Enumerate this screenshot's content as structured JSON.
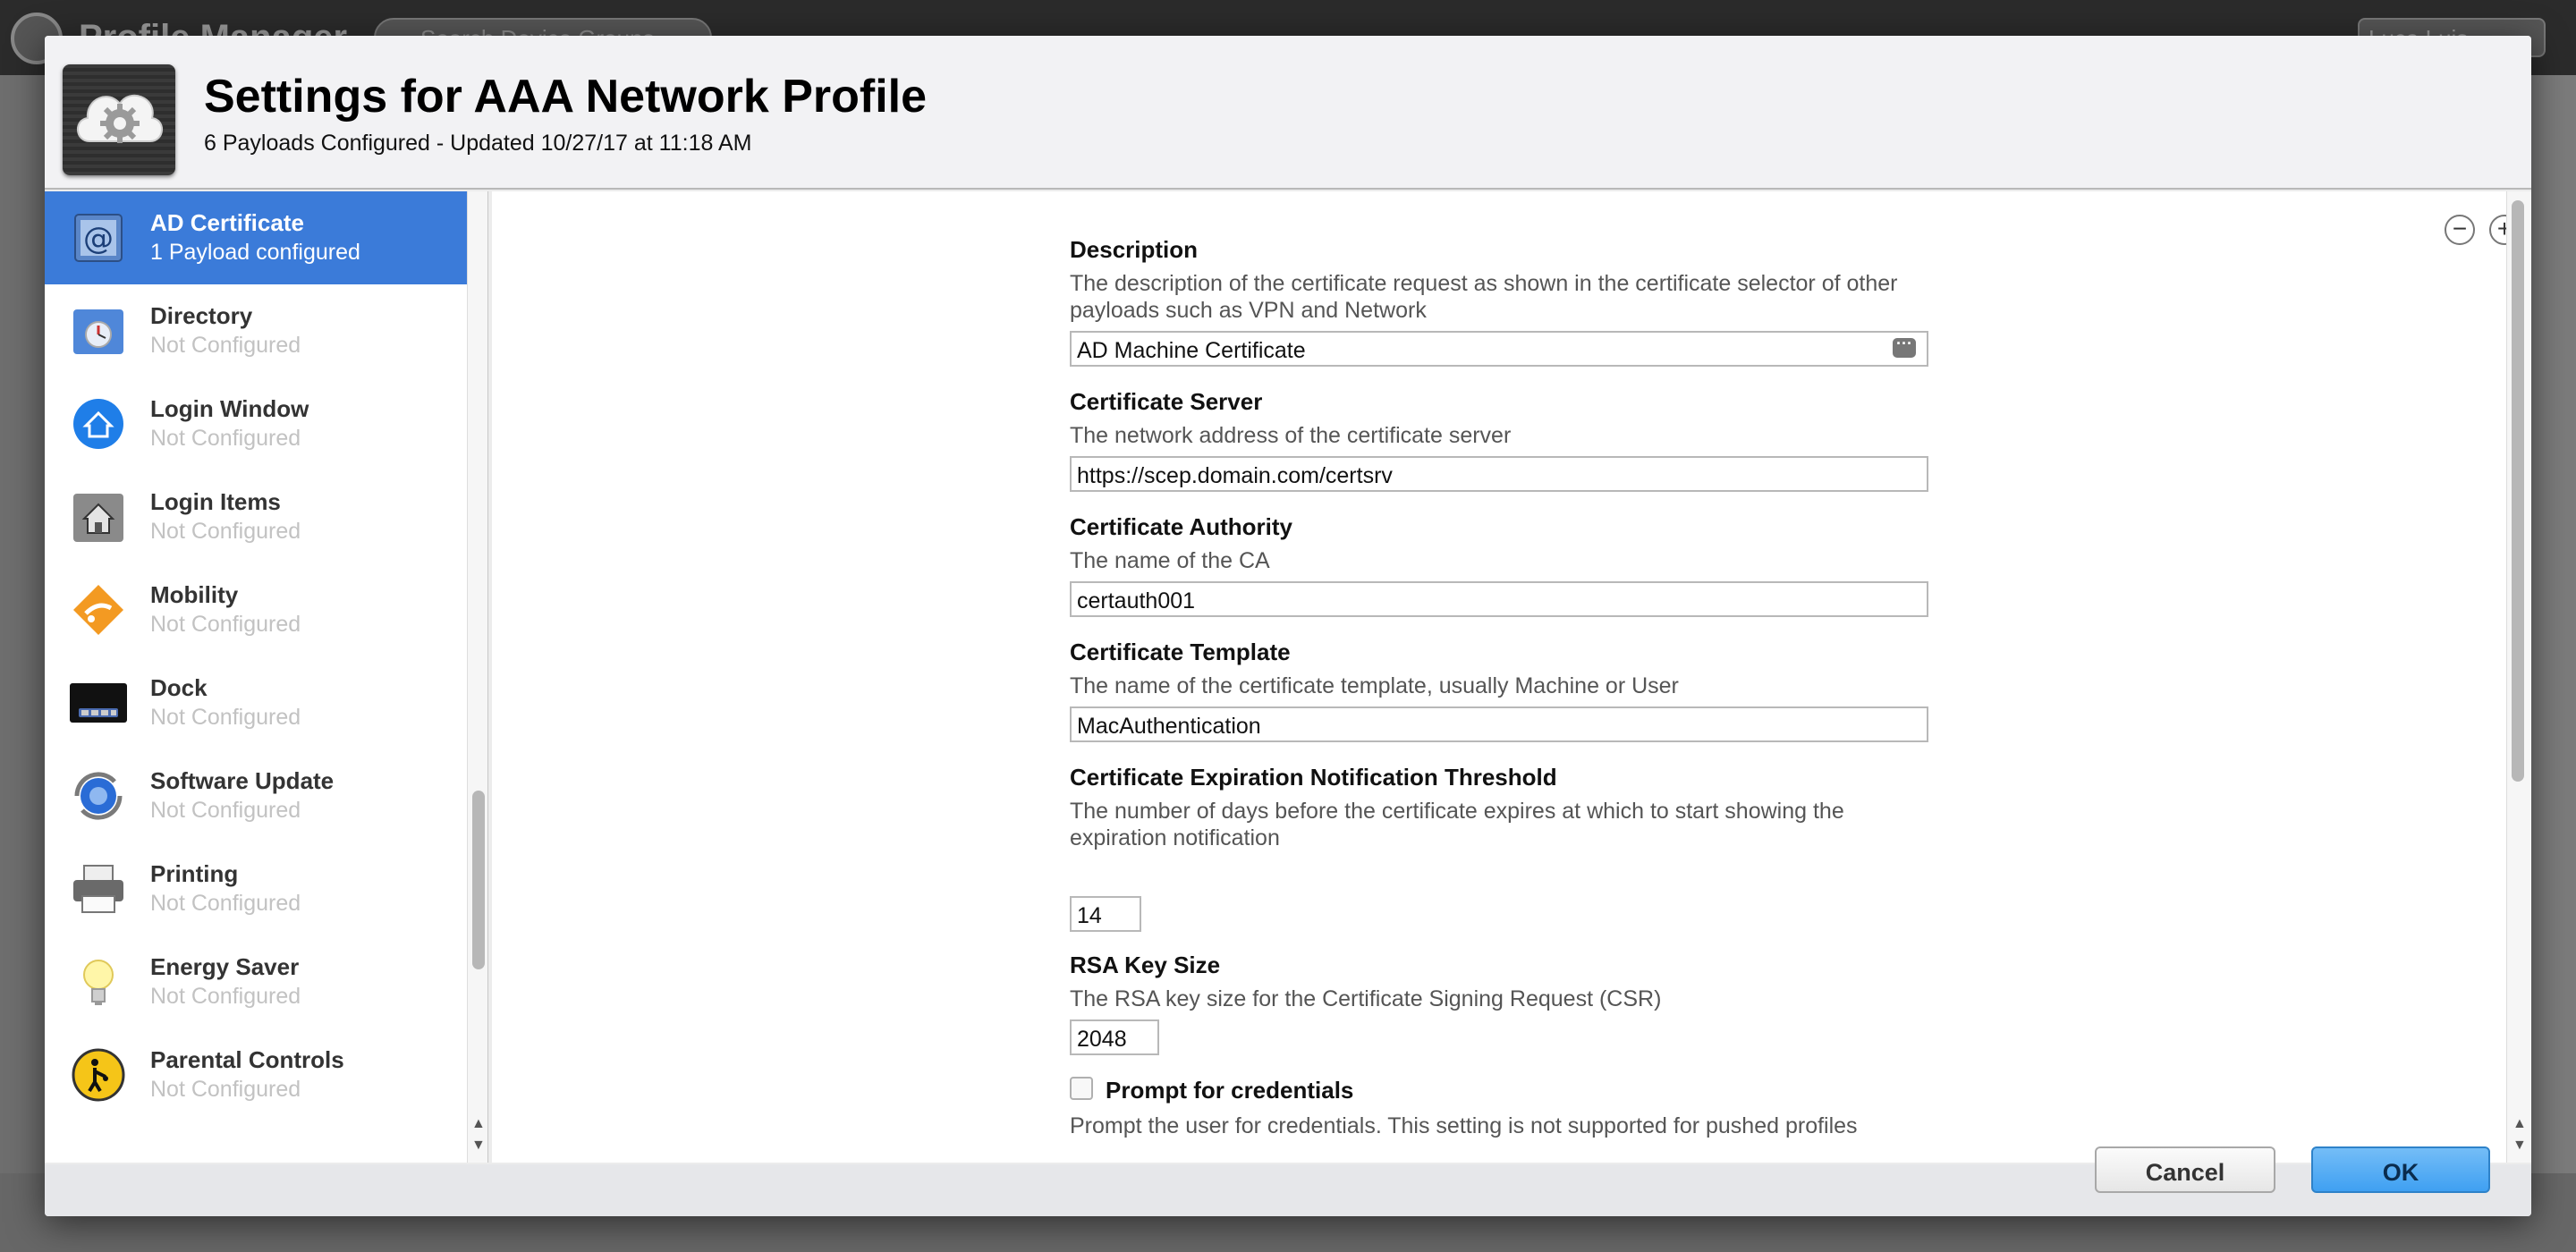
{
  "background_app": {
    "title": "Profile Manager",
    "search_placeholder": "Search Device Groups",
    "user_menu": "Luca Luis"
  },
  "sheet": {
    "title": "Settings for AAA Network Profile",
    "subtitle": "6 Payloads Configured - Updated 10/27/17 at 11:18 AM",
    "icon": "cloud-gear-icon"
  },
  "payloads": [
    {
      "name": "AD Certificate",
      "status": "1 Payload configured",
      "icon": "certificate-icon",
      "selected": true
    },
    {
      "name": "Directory",
      "status": "Not Configured",
      "icon": "directory-icon"
    },
    {
      "name": "Login Window",
      "status": "Not Configured",
      "icon": "home-icon"
    },
    {
      "name": "Login Items",
      "status": "Not Configured",
      "icon": "login-items-icon"
    },
    {
      "name": "Mobility",
      "status": "Not Configured",
      "icon": "mobility-icon"
    },
    {
      "name": "Dock",
      "status": "Not Configured",
      "icon": "dock-icon"
    },
    {
      "name": "Software Update",
      "status": "Not Configured",
      "icon": "software-update-icon"
    },
    {
      "name": "Printing",
      "status": "Not Configured",
      "icon": "printer-icon"
    },
    {
      "name": "Energy Saver",
      "status": "Not Configured",
      "icon": "lightbulb-icon"
    },
    {
      "name": "Parental Controls",
      "status": "Not Configured",
      "icon": "parental-controls-icon"
    }
  ],
  "form": {
    "description": {
      "title": "Description",
      "desc": "The description of the certificate request as shown in the certificate selector of other payloads such as VPN and Network",
      "value": "AD Machine Certificate"
    },
    "server": {
      "title": "Certificate Server",
      "desc": "The network address of the certificate server",
      "value": "https://scep.domain.com/certsrv"
    },
    "authority": {
      "title": "Certificate Authority",
      "desc": "The name of the CA",
      "value": "certauth001"
    },
    "template": {
      "title": "Certificate Template",
      "desc": "The name of the certificate template, usually Machine or User",
      "value": "MacAuthentication"
    },
    "expiration": {
      "title": "Certificate Expiration Notification Threshold",
      "desc": "The number of days before the certificate expires at which to start showing the expiration notification",
      "value": "14"
    },
    "rsa": {
      "title": "RSA Key Size",
      "desc": "The RSA key size for the Certificate Signing Request (CSR)",
      "value": "2048"
    },
    "prompt": {
      "label": "Prompt for credentials",
      "desc": "Prompt the user for credentials. This setting is not supported for pushed profiles",
      "checked": false
    }
  },
  "controls": {
    "remove": "−",
    "add": "+"
  },
  "footer": {
    "cancel": "Cancel",
    "ok": "OK"
  },
  "colors": {
    "selection": "#3b7bd9",
    "ok_button": "#4aa6f3"
  }
}
